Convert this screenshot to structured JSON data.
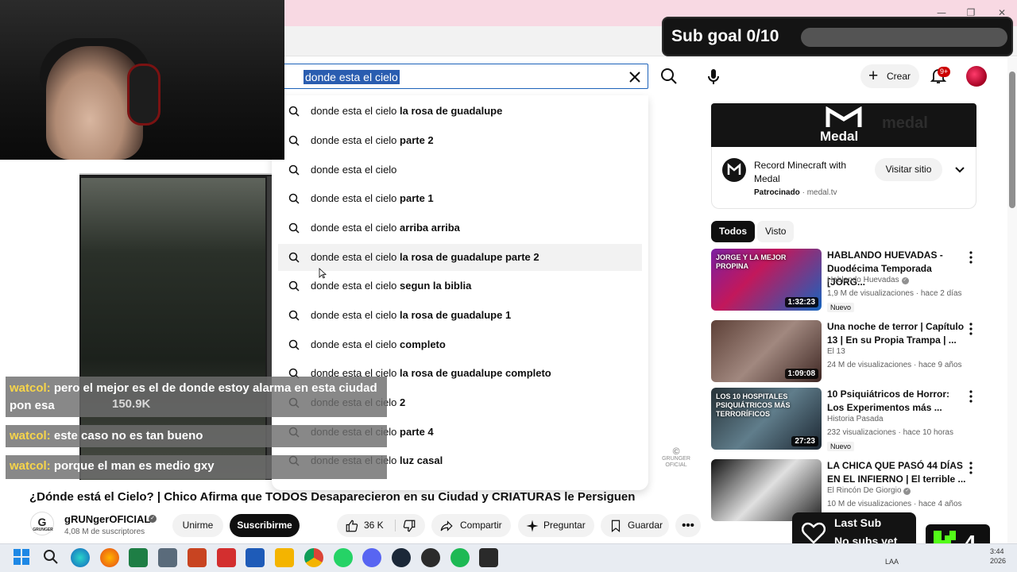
{
  "window": {
    "minimize": "—",
    "maximize": "❐",
    "close": "✕"
  },
  "search": {
    "query": "donde esta el cielo"
  },
  "header": {
    "create_label": "Crear",
    "notification_count": "9+"
  },
  "suggestions": [
    {
      "prefix": "donde esta el cielo ",
      "suffix": "la rosa de guadalupe"
    },
    {
      "prefix": "donde esta el cielo ",
      "suffix": "parte 2"
    },
    {
      "prefix": "donde esta el cielo",
      "suffix": ""
    },
    {
      "prefix": "donde esta el cielo ",
      "suffix": "parte 1"
    },
    {
      "prefix": "donde esta el cielo ",
      "suffix": "arriba arriba"
    },
    {
      "prefix": "donde esta el cielo ",
      "suffix": "la rosa de guadalupe parte 2"
    },
    {
      "prefix": "donde esta el cielo ",
      "suffix": "segun la biblia"
    },
    {
      "prefix": "donde esta el cielo ",
      "suffix": "la rosa de guadalupe 1"
    },
    {
      "prefix": "donde esta el cielo ",
      "suffix": "completo"
    },
    {
      "prefix": "donde esta el cielo ",
      "suffix": "la rosa de guadalupe completo"
    },
    {
      "prefix": "donde esta el cielo ",
      "suffix": "2"
    },
    {
      "prefix": "donde esta el cielo ",
      "suffix": "parte 4"
    },
    {
      "prefix": "donde esta el cielo ",
      "suffix": "luz casal"
    }
  ],
  "chat": [
    {
      "user": "watcol:",
      "message": "pero el mejor es el de donde estoy alarma en esta ciudad pon esa"
    },
    {
      "user": "watcol:",
      "message": "este caso no es tan bueno"
    },
    {
      "user": "watcol:",
      "message": "porque el man es medio gxy"
    }
  ],
  "viewers": "150.9K",
  "video": {
    "title": "¿Dónde está el Cielo? | Chico Afirma que TODOS Desaparecieron en su Ciudad y CRIATURAS le Persiguen",
    "channel": "gRUNgerOFICIAL",
    "channel_logo": "G",
    "channel_logo_sub": "GRUNGER",
    "subscribers": "4,08 M de suscriptores",
    "join_label": "Unirme",
    "subscribe_label": "Suscribirme",
    "likes": "36 K",
    "share_label": "Compartir",
    "ask_label": "Preguntar",
    "save_label": "Guardar",
    "watermark": "GRUNGER OFICIAL"
  },
  "ad": {
    "banner_text": "Medal",
    "banner_ghost": "medal",
    "title": "Record Minecraft with Medal",
    "sponsored": "Patrocinado",
    "domain": "medal.tv",
    "visit_label": "Visitar sitio"
  },
  "chips": [
    "Todos",
    "Visto"
  ],
  "recommendations": [
    {
      "title": "HABLANDO HUEVADAS - Duodécima Temporada [JORG...",
      "channel": "Hablando Huevadas",
      "verified": true,
      "meta": "1,9 M de visualizaciones · hace 2 días",
      "badge": "Nuevo",
      "duration": "1:32:23",
      "thumb_text": "JORGE Y LA MEJOR PROPINA"
    },
    {
      "title": "Una noche de terror | Capítulo 13 | En su Propia Trampa | ...",
      "channel": "El 13",
      "verified": false,
      "meta": "24 M de visualizaciones · hace 9 años",
      "badge": "",
      "duration": "1:09:08",
      "thumb_text": ""
    },
    {
      "title": "10 Psiquiátricos de Horror: Los Experimentos más ...",
      "channel": "Historia Pasada",
      "verified": false,
      "meta": "232 visualizaciones · hace 10 horas",
      "badge": "Nuevo",
      "duration": "27:23",
      "thumb_text": "LOS 10 HOSPITALES PSIQUIÁTRICOS MÁS TERRORÍFICOS"
    },
    {
      "title": "LA CHICA QUE PASÓ 44 DÍAS EN EL INFIERNO | El terrible ...",
      "channel": "El Rincón De Giorgio",
      "verified": true,
      "meta": "10 M de visualizaciones · hace 4 años",
      "badge": "",
      "duration": "",
      "thumb_text": ""
    }
  ],
  "overlays": {
    "sub_goal": "Sub goal 0/10",
    "last_sub_heading": "Last Sub",
    "last_sub_value": "No subs yet",
    "kick_count": "4"
  },
  "taskbar": {
    "lang": "LAA",
    "time": "3:44",
    "date": "2026"
  },
  "colors": {
    "accent": "#1c62b9",
    "subscribe": "#0f0f0f",
    "chat_user": "#f7d54a",
    "notification": "#cc0000"
  }
}
